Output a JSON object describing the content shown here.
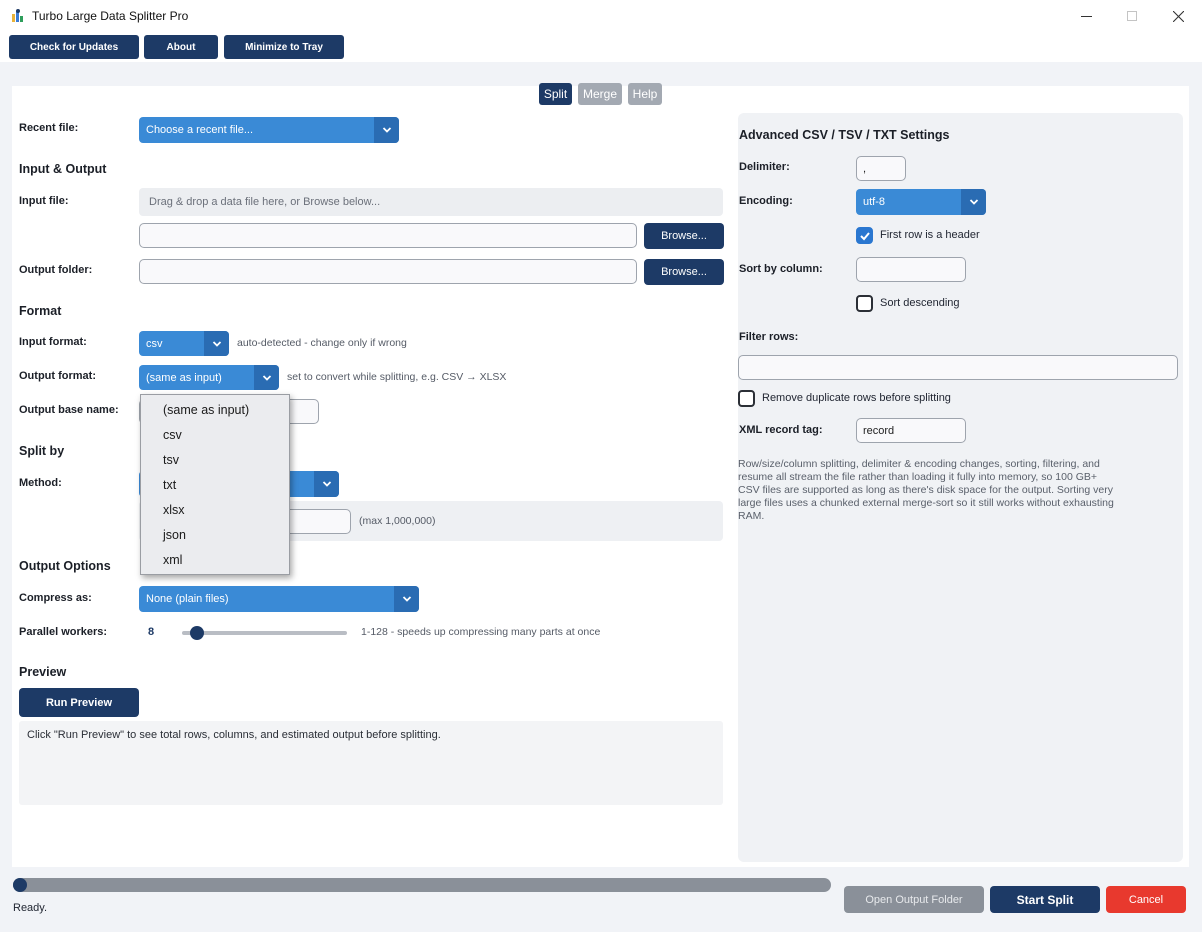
{
  "window": {
    "title": "Turbo Large Data Splitter Pro"
  },
  "toolbar": {
    "check_updates": "Check for Updates",
    "about": "About",
    "minimize_tray": "Minimize to Tray"
  },
  "tabs": [
    {
      "label": "Split",
      "active": true
    },
    {
      "label": "Merge",
      "active": false
    },
    {
      "label": "Help",
      "active": false
    }
  ],
  "recent": {
    "label": "Recent file:",
    "placeholder": "Choose a recent file..."
  },
  "io": {
    "section": "Input & Output",
    "input_label": "Input file:",
    "dropzone": "Drag & drop a data file here, or Browse below...",
    "input_value": "",
    "browse": "Browse...",
    "output_label": "Output folder:",
    "output_value": ""
  },
  "format": {
    "section": "Format",
    "input_label": "Input format:",
    "input_value": "csv",
    "input_hint": "auto-detected - change only if wrong",
    "output_label": "Output format:",
    "output_value": "(same as input)",
    "output_hint": "set to convert while splitting, e.g. CSV → XLSX",
    "basename_label": "Output base name:",
    "basename_value": "",
    "options": [
      "(same as input)",
      "csv",
      "tsv",
      "txt",
      "xlsx",
      "json",
      "xml"
    ]
  },
  "split": {
    "section": "Split by",
    "method_label": "Method:",
    "value_hint": "(max 1,000,000)"
  },
  "output_options": {
    "section": "Output Options",
    "compress_label": "Compress as:",
    "compress_value": "None (plain files)",
    "workers_label": "Parallel workers:",
    "workers_value": "8",
    "workers_min": 1,
    "workers_max": 128,
    "workers_hint": "1-128 - speeds up compressing many parts at once"
  },
  "preview": {
    "section": "Preview",
    "button": "Run Preview",
    "text": "Click \"Run Preview\" to see total rows, columns, and estimated output before splitting."
  },
  "advanced": {
    "title": "Advanced CSV / TSV / TXT Settings",
    "delimiter_label": "Delimiter:",
    "delimiter_value": ",",
    "encoding_label": "Encoding:",
    "encoding_value": "utf-8",
    "header_checkbox": "First row is a header",
    "header_checked": true,
    "sort_label": "Sort by column:",
    "sort_value": "",
    "sort_desc": "Sort descending",
    "sort_desc_checked": false,
    "filter_label": "Filter rows:",
    "filter_value": "",
    "dedupe": "Remove duplicate rows before splitting",
    "dedupe_checked": false,
    "xml_tag_label": "XML record tag:",
    "xml_tag_value": "record",
    "info": "Row/size/column splitting, delimiter & encoding changes, sorting, filtering, and resume all stream the file rather than loading it fully into memory, so 100 GB+ CSV files are supported as long as there's disk space for the output. Sorting very large files uses a chunked external merge-sort so it still works without exhausting RAM."
  },
  "status": {
    "text": "Ready.",
    "progress": 0,
    "open_folder": "Open Output Folder",
    "start": "Start Split",
    "cancel": "Cancel"
  },
  "colors": {
    "navy": "#1d3a66",
    "accent_blue": "#3a8ad6",
    "cancel_red": "#e8392e",
    "disabled_gray": "#8a9099"
  },
  "icons": {
    "app": "database-icon",
    "dropdown": "chevron-down-icon",
    "check": "checkmark-icon"
  }
}
